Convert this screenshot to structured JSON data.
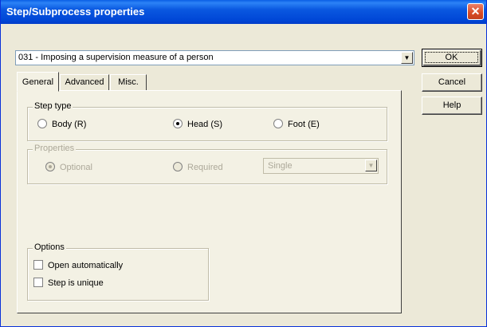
{
  "window": {
    "title": "Step/Subprocess properties",
    "close_label": "✕"
  },
  "process_combo": {
    "value": "031 - Imposing a supervision measure of a person",
    "arrow": "▼"
  },
  "buttons": {
    "ok": "OK",
    "cancel": "Cancel",
    "help": "Help"
  },
  "tabs": [
    {
      "label": "General",
      "active": true
    },
    {
      "label": "Advanced",
      "active": false
    },
    {
      "label": "Misc.",
      "active": false
    }
  ],
  "step_type": {
    "legend": "Step type",
    "options": [
      {
        "label": "Body (R)",
        "checked": false
      },
      {
        "label": "Head (S)",
        "checked": true
      },
      {
        "label": "Foot (E)",
        "checked": false
      }
    ]
  },
  "properties": {
    "legend": "Properties",
    "optional_label": "Optional",
    "required_label": "Required",
    "select_value": "Single",
    "enabled": false
  },
  "options": {
    "legend": "Options",
    "open_automatically": "Open automatically",
    "step_is_unique": "Step is unique"
  }
}
